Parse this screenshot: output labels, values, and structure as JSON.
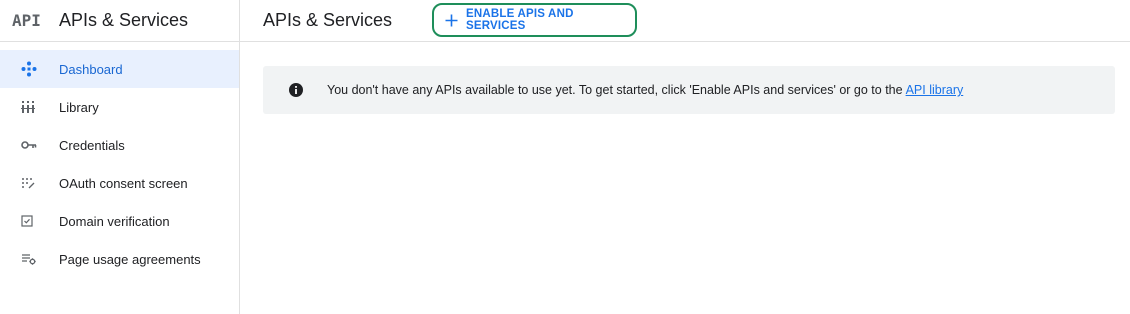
{
  "sidebar": {
    "logo_text": "API",
    "title": "APIs & Services",
    "items": [
      {
        "label": "Dashboard",
        "icon": "dashboard-diamond-icon",
        "active": true
      },
      {
        "label": "Library",
        "icon": "library-grid-icon",
        "active": false
      },
      {
        "label": "Credentials",
        "icon": "key-icon",
        "active": false
      },
      {
        "label": "OAuth consent screen",
        "icon": "oauth-dots-icon",
        "active": false
      },
      {
        "label": "Domain verification",
        "icon": "checkbox-icon",
        "active": false
      },
      {
        "label": "Page usage agreements",
        "icon": "settings-list-icon",
        "active": false
      }
    ]
  },
  "header": {
    "title": "APIs & Services",
    "enable_button_label": "ENABLE APIS AND SERVICES"
  },
  "banner": {
    "text": "You don't have any APIs available to use yet. To get started, click 'Enable APIs and services' or go to the",
    "link_text": "API library"
  },
  "colors": {
    "accent": "#1a73e8",
    "active_bg": "#e8f0fe",
    "highlight_border": "#1e8e5a",
    "banner_bg": "#f1f3f4"
  }
}
